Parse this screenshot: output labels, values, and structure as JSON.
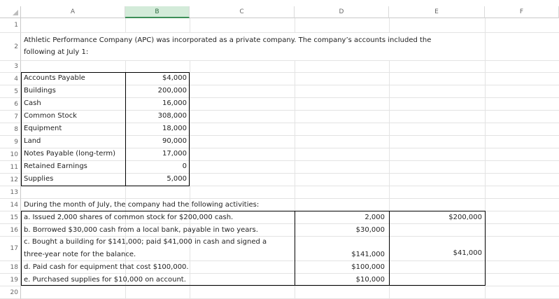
{
  "columns": [
    "A",
    "B",
    "C",
    "D",
    "E",
    "F"
  ],
  "rows": [
    "1",
    "2",
    "3",
    "4",
    "5",
    "6",
    "7",
    "8",
    "9",
    "10",
    "11",
    "12",
    "13",
    "14",
    "15",
    "16",
    "17",
    "18",
    "19",
    "20"
  ],
  "intro": {
    "line1": "Athletic Performance Company (APC) was incorporated as a private company. The company’s accounts included the",
    "line2": "following at July 1:"
  },
  "accounts": [
    {
      "name": "Accounts Payable",
      "amount": "$4,000"
    },
    {
      "name": "Buildings",
      "amount": "200,000"
    },
    {
      "name": "Cash",
      "amount": "16,000"
    },
    {
      "name": "Common Stock",
      "amount": "308,000"
    },
    {
      "name": "Equipment",
      "amount": "18,000"
    },
    {
      "name": "Land",
      "amount": "90,000"
    },
    {
      "name": "Notes Payable (long-term)",
      "amount": "17,000"
    },
    {
      "name": "Retained Earnings",
      "amount": "0"
    },
    {
      "name": "Supplies",
      "amount": "5,000"
    }
  ],
  "activities_heading": "During the month of July, the company had the following activities:",
  "activities": [
    {
      "text1": "a. Issued 2,000 shares of common stock for $200,000 cash.",
      "text2": "",
      "d": "2,000",
      "e": "$200,000"
    },
    {
      "text1": "b. Borrowed $30,000 cash from a local bank, payable in two years.",
      "text2": "",
      "d": "$30,000",
      "e": ""
    },
    {
      "text1": "c. Bought a building for $141,000; paid $41,000 in cash and signed a",
      "text2": "three-year note for the balance.",
      "d": "$141,000",
      "e": "$41,000"
    },
    {
      "text1": "d. Paid cash for equipment that cost $100,000.",
      "text2": "",
      "d": "$100,000",
      "e": ""
    },
    {
      "text1": "e. Purchased supplies for $10,000 on account.",
      "text2": "",
      "d": "$10,000",
      "e": ""
    }
  ]
}
